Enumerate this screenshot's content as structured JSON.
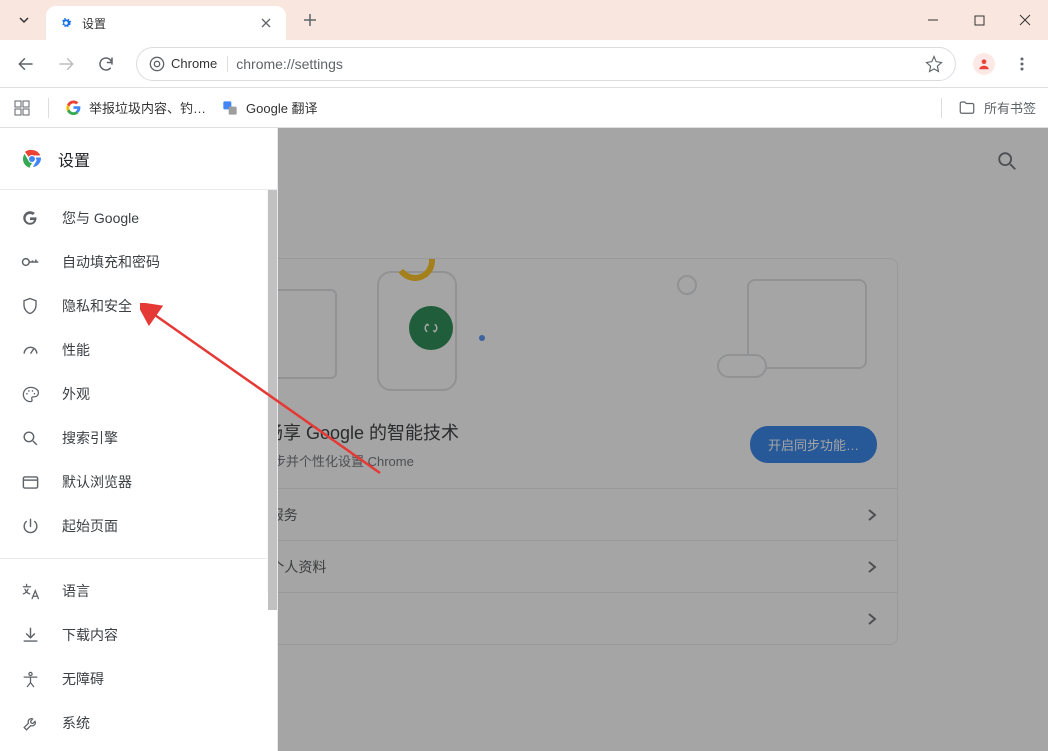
{
  "tab": {
    "title": "设置"
  },
  "address": {
    "chip": "Chrome",
    "url": "chrome://settings"
  },
  "bookmarks": {
    "item1": "举报垃圾内容、钓…",
    "item2": "Google 翻译",
    "all": "所有书签"
  },
  "settings": {
    "title": "设置",
    "nav": {
      "you_and_google": "您与 Google",
      "autofill": "自动填充和密码",
      "privacy": "隐私和安全",
      "performance": "性能",
      "appearance": "外观",
      "search_engine": "搜索引擎",
      "default_browser": "默认浏览器",
      "on_startup": "起始页面",
      "language": "语言",
      "downloads": "下载内容",
      "accessibility": "无障碍",
      "system": "系统"
    }
  },
  "main": {
    "card_title": "中畅享 Google 的智能技术",
    "card_sub": "上同步并个性化设置 Chrome",
    "sync_button": "开启同步功能…",
    "row1": "gle 服务",
    "row2": "me 个人资料"
  }
}
